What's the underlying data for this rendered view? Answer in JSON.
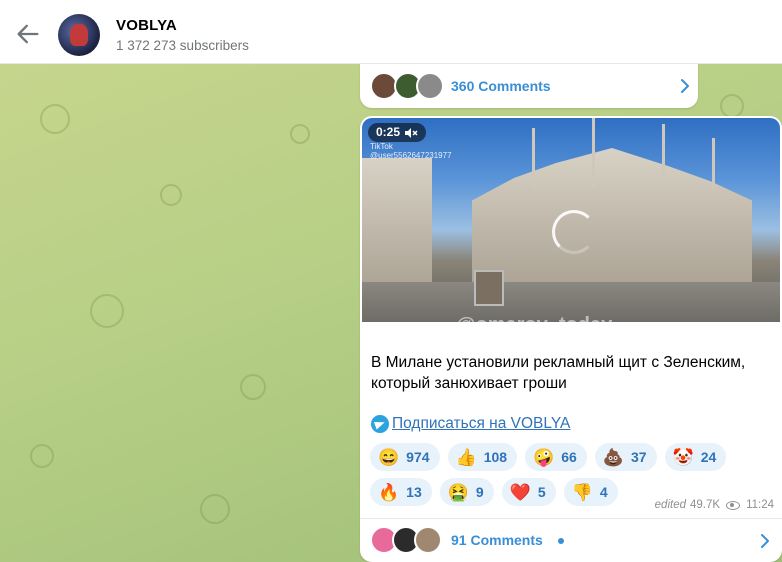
{
  "header": {
    "channel_name": "VOBLYA",
    "subscribers": "1 372 273 subscribers",
    "back_icon": "arrow-left-icon"
  },
  "top_comments": {
    "label": "360 Comments",
    "avatars": [
      "#6b4a3a",
      "#3d5c2f",
      "#8a8a8a"
    ]
  },
  "post": {
    "video": {
      "duration": "0:25",
      "muted_icon": "speaker-muted-icon",
      "tiktok_label": "TikTok",
      "tiktok_id": "@user5562647231977",
      "watermark": "@omarov_today"
    },
    "text": "В Милане установили рекламный щит с Зеленским, который занюхивает гроши",
    "subscribe_link": "Подписаться на VOBLYA",
    "reactions": [
      {
        "emoji": "😄",
        "count": "974"
      },
      {
        "emoji": "👍",
        "count": "108"
      },
      {
        "emoji": "🤪",
        "count": "66"
      },
      {
        "emoji": "💩",
        "count": "37"
      },
      {
        "emoji": "🤡",
        "count": "24"
      },
      {
        "emoji": "🔥",
        "count": "13"
      },
      {
        "emoji": "🤮",
        "count": "9"
      },
      {
        "emoji": "❤️",
        "count": "5"
      },
      {
        "emoji": "👎",
        "count": "4"
      }
    ],
    "edited": "edited",
    "views": "49.7K",
    "time": "11:24",
    "comments": {
      "label": "91 Comments",
      "avatars": [
        "#e86a9a",
        "#2b2b2b",
        "#a08770"
      ]
    }
  },
  "colors": {
    "accent": "#3a8fd4",
    "link": "#2f73b8",
    "reaction_bg": "#e8f2fb"
  }
}
